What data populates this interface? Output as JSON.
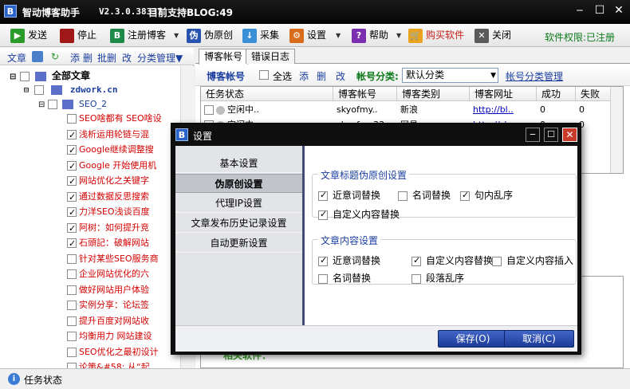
{
  "app": {
    "logo": "B",
    "title": "智动博客助手",
    "version": "V2.3.0.38337",
    "support": "目前支持BLOG:49",
    "permission": "软件权限:已注册"
  },
  "toolbar": {
    "send": "发送",
    "stop": "停止",
    "register": "注册博客",
    "pseudo": "伪原创",
    "collect": "采集",
    "settings": "设置",
    "help": "帮助",
    "buy": "购买软件",
    "close": "关闭"
  },
  "left_tools": {
    "article": "文章",
    "add": "添",
    "del": "删",
    "batch": "批删",
    "edit": "改",
    "category": "分类管理▼"
  },
  "tree": {
    "root": "全部文章",
    "site": "zdwork.cn",
    "folder": "SEO_2",
    "articles": [
      {
        "title": "SEO啥都有 SEO啥设",
        "checked": false
      },
      {
        "title": "浅析运用轮链与混",
        "checked": true
      },
      {
        "title": "Google继续调整搜",
        "checked": true
      },
      {
        "title": "Google 开始使用机",
        "checked": true
      },
      {
        "title": "网站优化之关键字",
        "checked": true
      },
      {
        "title": "通过数据反思搜索",
        "checked": true
      },
      {
        "title": "力洋SEO浅谈百度",
        "checked": true
      },
      {
        "title": "阿树：如何提升竞",
        "checked": true
      },
      {
        "title": "石頭記：破解网站",
        "checked": true
      },
      {
        "title": "针对某些SEO服务商",
        "checked": false
      },
      {
        "title": "企业网站优化的六",
        "checked": false
      },
      {
        "title": "做好网站用户体验",
        "checked": false
      },
      {
        "title": "实例分享：论坛签",
        "checked": false
      },
      {
        "title": "提升百度对网站收",
        "checked": false
      },
      {
        "title": "均衡用力 网站建设",
        "checked": false
      },
      {
        "title": "SEO优化之最初设计",
        "checked": false
      },
      {
        "title": "论策&#58; 从“起",
        "checked": false
      }
    ]
  },
  "tabs": {
    "accounts": "博客帐号",
    "errors": "错误日志"
  },
  "acct_bar": {
    "label": "博客帐号",
    "select_all": "全选",
    "add": "添",
    "del": "删",
    "edit": "改",
    "cat_label": "帐号分类:",
    "cat_value": "默认分类",
    "manage": "帐号分类管理"
  },
  "grid": {
    "headers": [
      "任务状态",
      "博客帐号",
      "博客类别",
      "博客网址",
      "成功",
      "失败"
    ],
    "rows": [
      [
        "空闲中..",
        "skyofmy..",
        "新浪",
        "http://bl..",
        "0",
        "0"
      ],
      [
        "空闲中..",
        "skyofmy33..",
        "网易",
        "http://sk..",
        "0",
        "0"
      ]
    ]
  },
  "bottom_text": "相关软件：",
  "status": {
    "label": "任务状态"
  },
  "dialog": {
    "icon": "B",
    "title": "设置",
    "nav": [
      "基本设置",
      "伪原创设置",
      "代理IP设置",
      "文章发布历史记录设置",
      "自动更新设置"
    ],
    "group1": {
      "title": "文章标题伪原创设置",
      "options": [
        {
          "label": "近意词替换",
          "checked": true
        },
        {
          "label": "名词替换",
          "checked": false
        },
        {
          "label": "句内乱序",
          "checked": true
        },
        {
          "label": "自定义内容替换",
          "checked": true
        }
      ]
    },
    "group2": {
      "title": "文章内容设置",
      "options": [
        {
          "label": "近意词替换",
          "checked": true
        },
        {
          "label": "自定义内容替换",
          "checked": true
        },
        {
          "label": "自定义内容插入",
          "checked": false
        },
        {
          "label": "名词替换",
          "checked": false
        },
        {
          "label": "段落乱序",
          "checked": false
        }
      ]
    },
    "save": "保存(O)",
    "cancel": "取消(C)"
  },
  "colors": {
    "accent": "#1c3fa0",
    "article_red": "#d40000",
    "permission_green": "#0b7a1a",
    "dialog_button": "#2b4fb3"
  }
}
